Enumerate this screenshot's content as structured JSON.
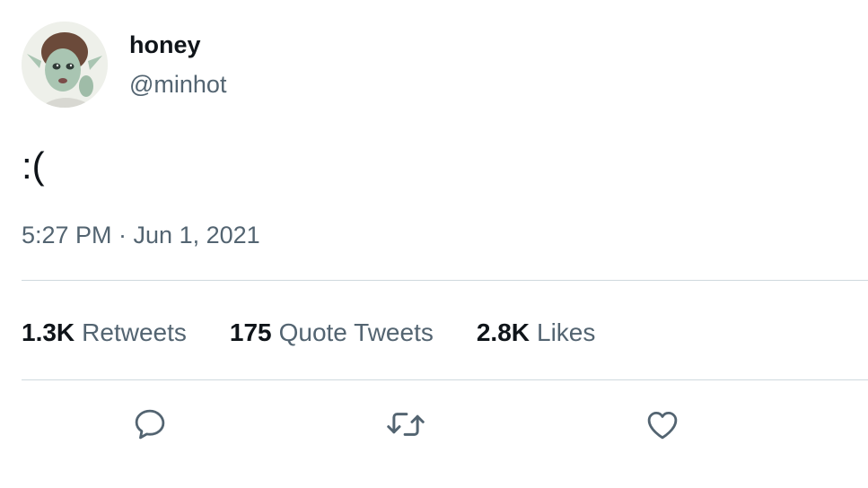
{
  "user": {
    "display_name": "honey",
    "handle": "@minhot",
    "avatar_icon": "profile-avatar"
  },
  "tweet": {
    "text": ":(",
    "timestamp": "5:27 PM · Jun 1, 2021"
  },
  "stats": [
    {
      "count": "1.3K",
      "label": "Retweets"
    },
    {
      "count": "175",
      "label": "Quote Tweets"
    },
    {
      "count": "2.8K",
      "label": "Likes"
    }
  ],
  "actions": {
    "reply_icon": "comment-icon",
    "retweet_icon": "retweet-icon",
    "like_icon": "heart-icon",
    "icon_color": "#536471"
  },
  "colors": {
    "primary_text": "#0f1419",
    "secondary_text": "#536471",
    "divider": "#cfd9de"
  }
}
